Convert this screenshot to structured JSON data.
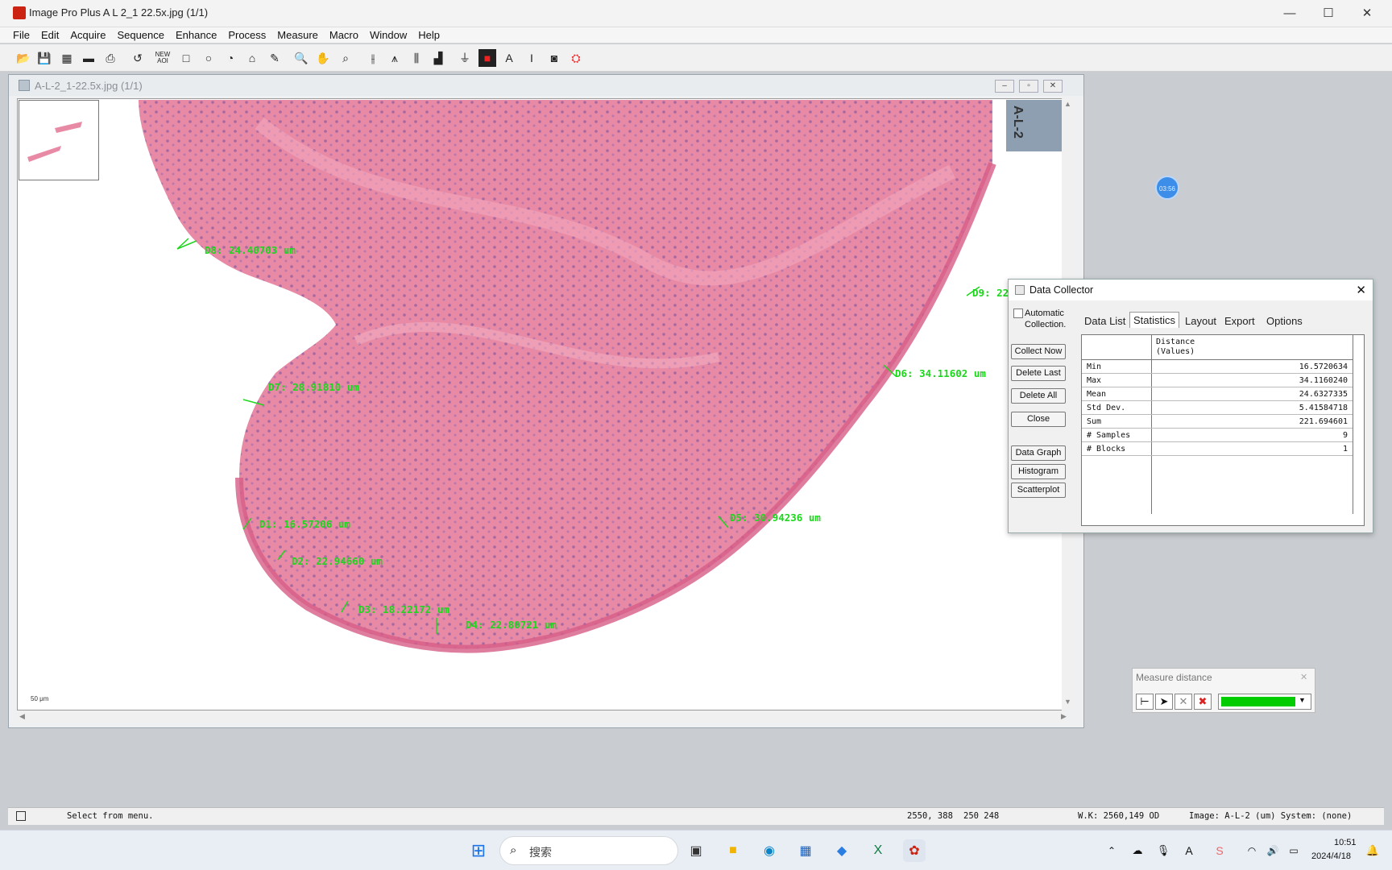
{
  "app": {
    "title": "Image Pro Plus  A L 2_1 22.5x.jpg (1/1)"
  },
  "window_controls": {
    "minimize": "—",
    "maximize": "☐",
    "close": "✕"
  },
  "menu": [
    "File",
    "Edit",
    "Acquire",
    "Sequence",
    "Enhance",
    "Process",
    "Measure",
    "Macro",
    "Window",
    "Help"
  ],
  "toolbar": {
    "new_aoi": "NEW AOI"
  },
  "image_window": {
    "title": "A-L-2_1-22.5x.jpg (1/1)",
    "label_strip": "A-L-2",
    "scale_label": "50 μm"
  },
  "measurements": [
    {
      "id": "D8",
      "text": "D8: 24.40703 um"
    },
    {
      "id": "D9",
      "text": "D9: 22."
    },
    {
      "id": "D6",
      "text": "D6: 34.11602 um"
    },
    {
      "id": "D7",
      "text": "D7: 28.91810 um"
    },
    {
      "id": "D1",
      "text": "D1: 16.57206 um"
    },
    {
      "id": "D5",
      "text": "D5: 30.94236 um"
    },
    {
      "id": "D2",
      "text": "D2: 22.94660 um"
    },
    {
      "id": "D3",
      "text": "D3: 18.22172 um"
    },
    {
      "id": "D4",
      "text": "D4: 22.80721 um"
    }
  ],
  "floating_badge": "03:56",
  "data_collector": {
    "title": "Data Collector",
    "auto_collection": "Automatic Collection.",
    "buttons": [
      "Collect Now",
      "Delete Last",
      "Delete All",
      "Close",
      "Data Graph",
      "Histogram",
      "Scatterplot"
    ],
    "tabs": [
      "Data List",
      "Statistics",
      "Layout",
      "Export",
      "Options"
    ],
    "active_tab": "Statistics",
    "column_header": "Distance (Values)",
    "rows": [
      {
        "k": "Min",
        "v": "16.5720634"
      },
      {
        "k": "Max",
        "v": "34.1160240"
      },
      {
        "k": "Mean",
        "v": "24.6327335"
      },
      {
        "k": "Std Dev.",
        "v": "5.41584718"
      },
      {
        "k": "Sum",
        "v": "221.694601"
      },
      {
        "k": "# Samples",
        "v": "9"
      },
      {
        "k": "# Blocks",
        "v": "1"
      }
    ]
  },
  "measure_distance": {
    "title": "Measure distance",
    "color": "#00cc00"
  },
  "status": {
    "hint": "Select from menu.",
    "coords": "2550, 388",
    "size": "250 248",
    "wk": "W.K: 2560,149 OD",
    "image": "Image: A-L-2 (um) System: (none)"
  },
  "taskbar": {
    "search_placeholder": "搜索",
    "time": "10:51",
    "date": "2024/4/18"
  }
}
